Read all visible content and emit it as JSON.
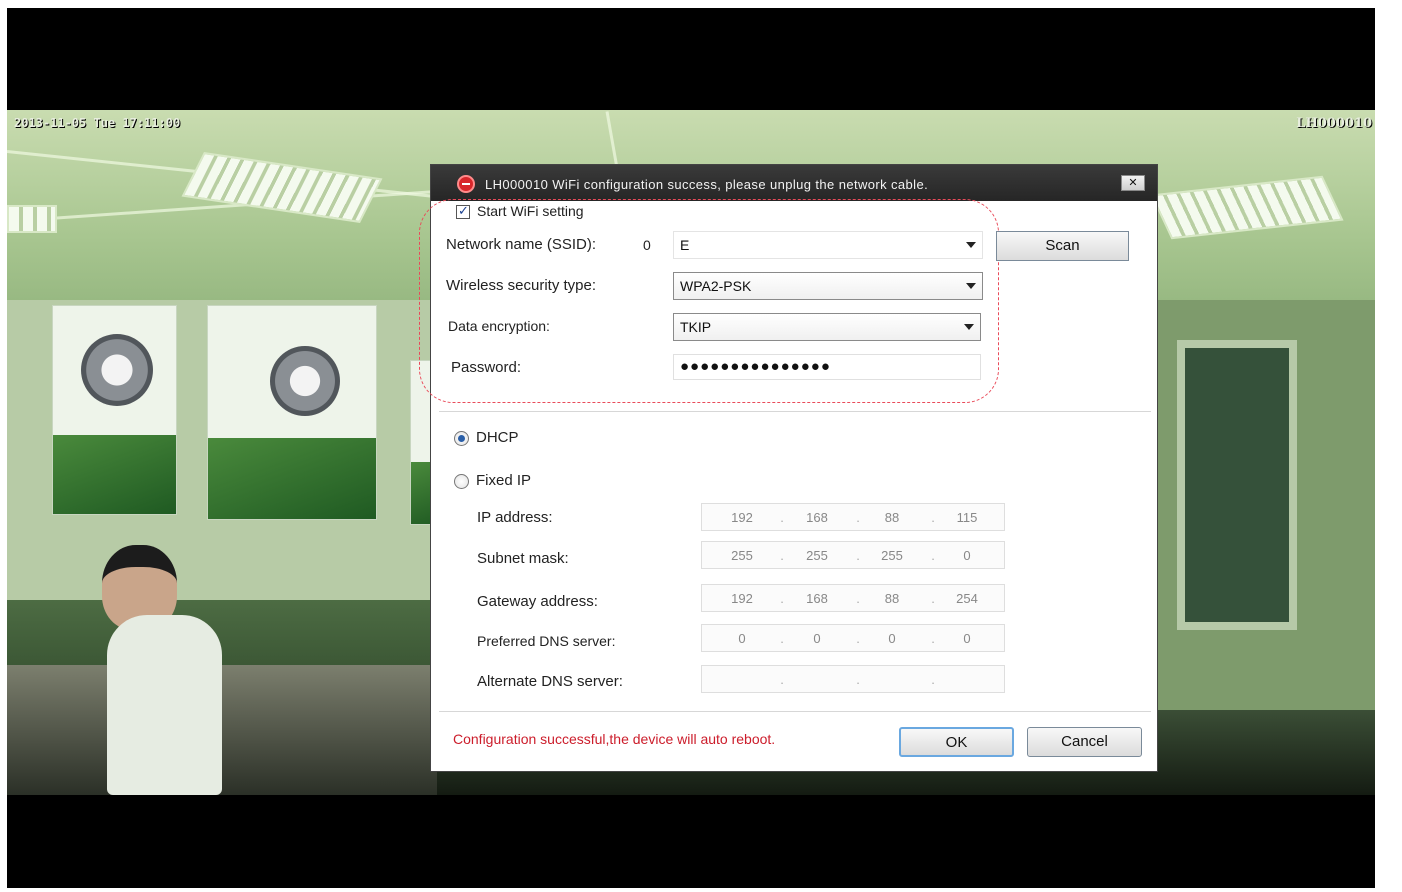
{
  "overlay": {
    "datetime": "2013-11-05 Tue 17:11:00",
    "camera_id": "LH000010"
  },
  "dialog": {
    "title": "LH000010 WiFi configuration success, please unplug the network cable.",
    "close_label": "✕",
    "start_wifi_label": "Start WiFi setting",
    "start_wifi_checked": true,
    "ssid_label": "Network name (SSID):",
    "ssid_prefix": "0",
    "ssid_value": "E",
    "scan_label": "Scan",
    "security_label": "Wireless security type:",
    "security_value": "WPA2-PSK",
    "encryption_label": "Data encryption:",
    "encryption_value": "TKIP",
    "password_label": "Password:",
    "password_value": "●●●●●●●●●●●●●●●",
    "dhcp_label": "DHCP",
    "fixed_ip_label": "Fixed IP",
    "selected_mode": "DHCP",
    "ip_label": "IP address:",
    "ip_value": [
      "192",
      "168",
      "88",
      "115"
    ],
    "subnet_label": "Subnet mask:",
    "subnet_value": [
      "255",
      "255",
      "255",
      "0"
    ],
    "gateway_label": "Gateway address:",
    "gateway_value": [
      "192",
      "168",
      "88",
      "254"
    ],
    "dns1_label": "Preferred DNS server:",
    "dns1_value": [
      "0",
      "0",
      "0",
      "0"
    ],
    "dns2_label": "Alternate DNS server:",
    "dns2_value": [
      "",
      "",
      "",
      ""
    ],
    "status_message": "Configuration successful,the device will auto reboot.",
    "ok_label": "OK",
    "cancel_label": "Cancel",
    "ip_dot": "."
  },
  "colors": {
    "status_text": "#cc1d2b",
    "highlight_border": "#e94b5a",
    "titlebar": "#2e2e2e"
  }
}
